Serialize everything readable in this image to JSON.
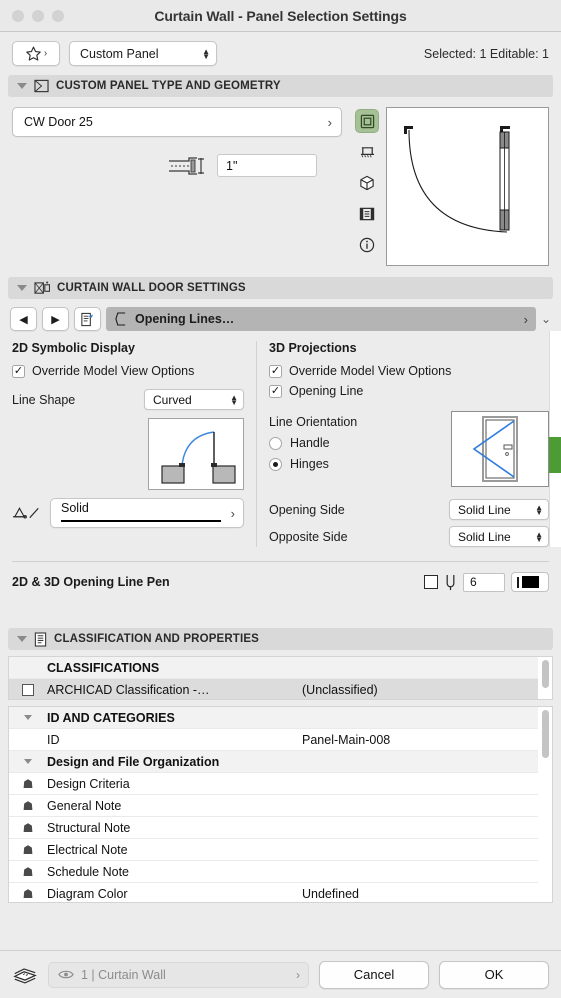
{
  "window": {
    "title": "Curtain Wall - Panel Selection Settings"
  },
  "toolbar": {
    "favorites_icon": "star-icon",
    "favorites_chevron": "›",
    "preset": "Custom Panel",
    "selection_info": "Selected: 1 Editable: 1"
  },
  "sections": {
    "panel_type": {
      "title": "CUSTOM PANEL TYPE AND GEOMETRY",
      "icon": "custom-panel-icon",
      "object_name": "CW Door 25",
      "object_chevron": "›",
      "thickness_icon": "panel-thickness-icon",
      "thickness_value": "1\"",
      "rail": [
        {
          "name": "plan-view-icon",
          "active": true
        },
        {
          "name": "elevation-view-icon",
          "active": false
        },
        {
          "name": "3d-view-icon",
          "active": false
        },
        {
          "name": "section-view-icon",
          "active": false
        },
        {
          "name": "info-icon",
          "active": false
        }
      ]
    },
    "door_settings": {
      "title": "CURTAIN WALL DOOR SETTINGS",
      "icon": "curtain-wall-door-icon",
      "prev_button": "◀",
      "next_button": "▶",
      "page_button_icon": "page-jump-icon",
      "tab_icon": "opening-lines-icon",
      "tab_label": "Opening Lines…",
      "tab_chevron": "›",
      "tab_dropdown": "⌄",
      "col_2d": {
        "header": "2D Symbolic Display",
        "override_label": "Override Model View Options",
        "override_checked": true,
        "line_shape_label": "Line Shape",
        "line_shape_value": "Curved",
        "linetype_icon": "linetype-icon",
        "linetype_value": "Solid",
        "linetype_chevron": "›"
      },
      "col_3d": {
        "header": "3D Projections",
        "override_label": "Override Model View Options",
        "override_checked": true,
        "opening_line_label": "Opening Line",
        "opening_line_checked": true,
        "orientation_label": "Line Orientation",
        "option_handle": "Handle",
        "option_hinges": "Hinges",
        "orientation_selected": "Hinges",
        "opening_side_label": "Opening Side",
        "opening_side_value": "Solid Line",
        "opposite_side_label": "Opposite Side",
        "opposite_side_value": "Solid Line"
      },
      "pen": {
        "label": "2D & 3D Opening Line Pen",
        "checkbox_icon": "pen-override-checkbox",
        "pen_icon": "pen-icon",
        "pen_number": "6",
        "swatch_name": "pen-color-swatch"
      }
    },
    "classification": {
      "title": "CLASSIFICATION AND PROPERTIES",
      "icon": "classification-icon",
      "classifications_header": "CLASSIFICATIONS",
      "rows": [
        {
          "name": "ARCHICAD Classification -…",
          "value": "(Unclassified)",
          "icon": "checkbox-icon",
          "selected": true
        }
      ]
    },
    "id_categories": {
      "group_header": "ID AND CATEGORIES",
      "rows": [
        {
          "icon": "",
          "name": "ID",
          "value": "Panel-Main-008",
          "type": "value"
        },
        {
          "icon": "",
          "name": "Design and File Organization",
          "value": "",
          "type": "group"
        },
        {
          "icon": "link-icon",
          "name": "Design Criteria",
          "value": "",
          "type": "prop"
        },
        {
          "icon": "link-icon",
          "name": "General Note",
          "value": "",
          "type": "prop"
        },
        {
          "icon": "link-icon",
          "name": "Structural Note",
          "value": "",
          "type": "prop"
        },
        {
          "icon": "link-icon",
          "name": "Electrical Note",
          "value": "",
          "type": "prop"
        },
        {
          "icon": "link-icon",
          "name": "Schedule Note",
          "value": "",
          "type": "prop"
        },
        {
          "icon": "link-icon",
          "name": "Diagram Color",
          "value": "Undefined",
          "type": "prop"
        }
      ]
    }
  },
  "footer": {
    "layers_icon": "layers-icon",
    "eye_icon": "eye-icon",
    "layer_value": "1 | Curtain Wall",
    "layer_chevron": "›",
    "cancel": "Cancel",
    "ok": "OK"
  },
  "colors": {
    "accent_green": "#4c9b35",
    "rail_active": "#a7c196",
    "preview_blue": "#3d87e0",
    "tab_selected": "#b4b4b4"
  }
}
